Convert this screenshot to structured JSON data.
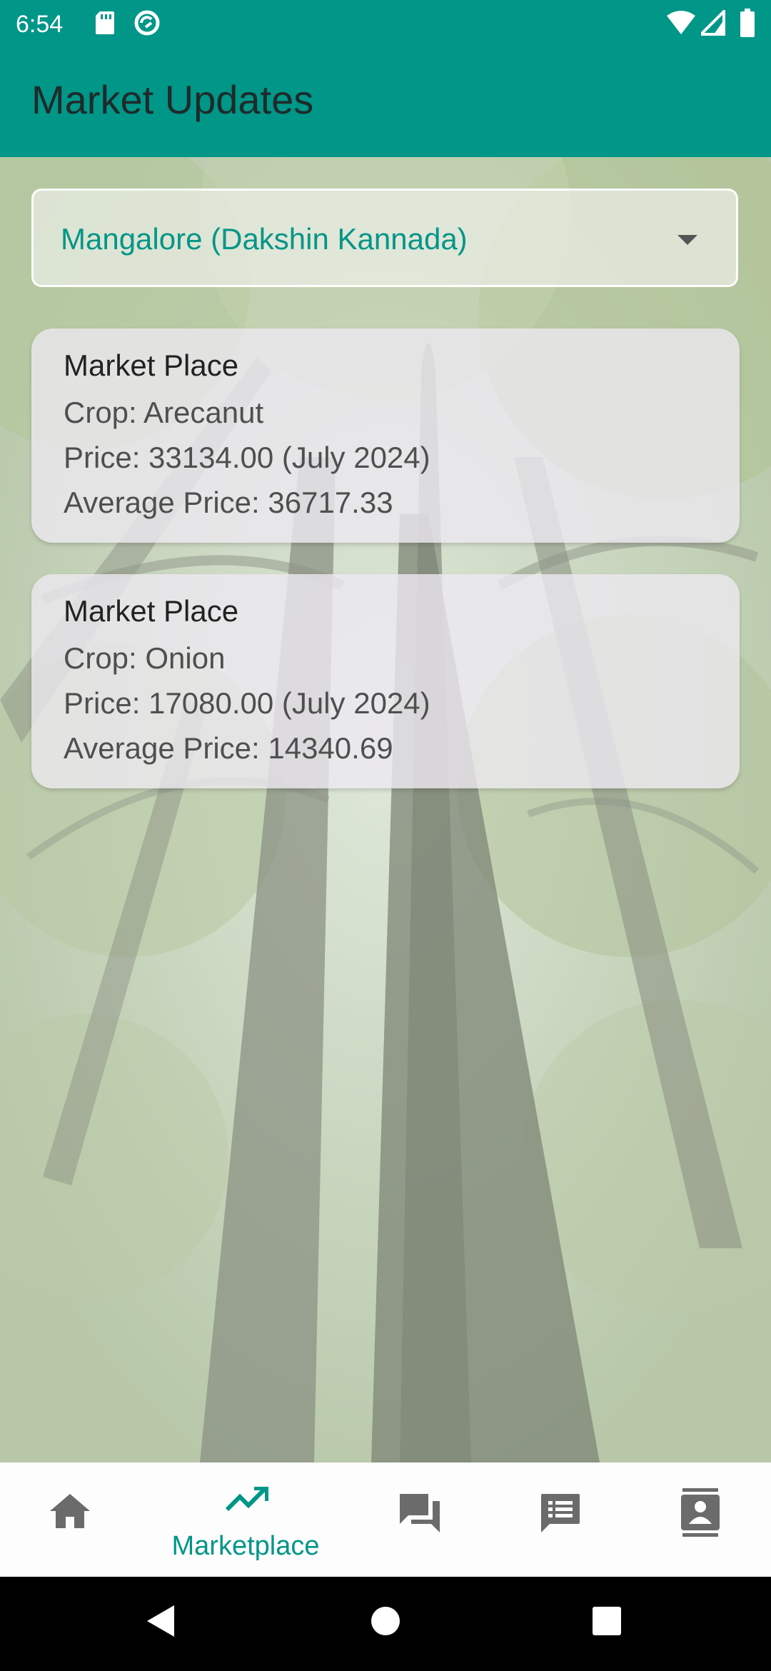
{
  "status_bar": {
    "time": "6:54",
    "icons": [
      "sd-card-icon",
      "sync-icon",
      "wifi-icon",
      "signal-icon",
      "battery-icon"
    ]
  },
  "app_bar": {
    "title": "Market Updates"
  },
  "dropdown": {
    "selected": "Mangalore (Dakshin Kannada)"
  },
  "cards": [
    {
      "title": "Market Place",
      "crop": "Crop: Arecanut",
      "price": "Price: 33134.00 (July 2024)",
      "average": "Average Price: 36717.33"
    },
    {
      "title": "Market Place",
      "crop": "Crop: Onion",
      "price": "Price: 17080.00 (July 2024)",
      "average": "Average Price: 14340.69"
    }
  ],
  "bottom_nav": {
    "active": "marketplace",
    "items": [
      {
        "id": "home",
        "icon": "home-icon"
      },
      {
        "id": "marketplace",
        "icon": "trending-up-icon",
        "label": "Marketplace"
      },
      {
        "id": "forum",
        "icon": "forum-icon"
      },
      {
        "id": "feed",
        "icon": "feed-icon"
      },
      {
        "id": "contacts",
        "icon": "contact-icon"
      }
    ]
  },
  "colors": {
    "primary": "#009688",
    "nav_inactive": "#6b6b6b",
    "card_bg": "#ece9f0"
  }
}
